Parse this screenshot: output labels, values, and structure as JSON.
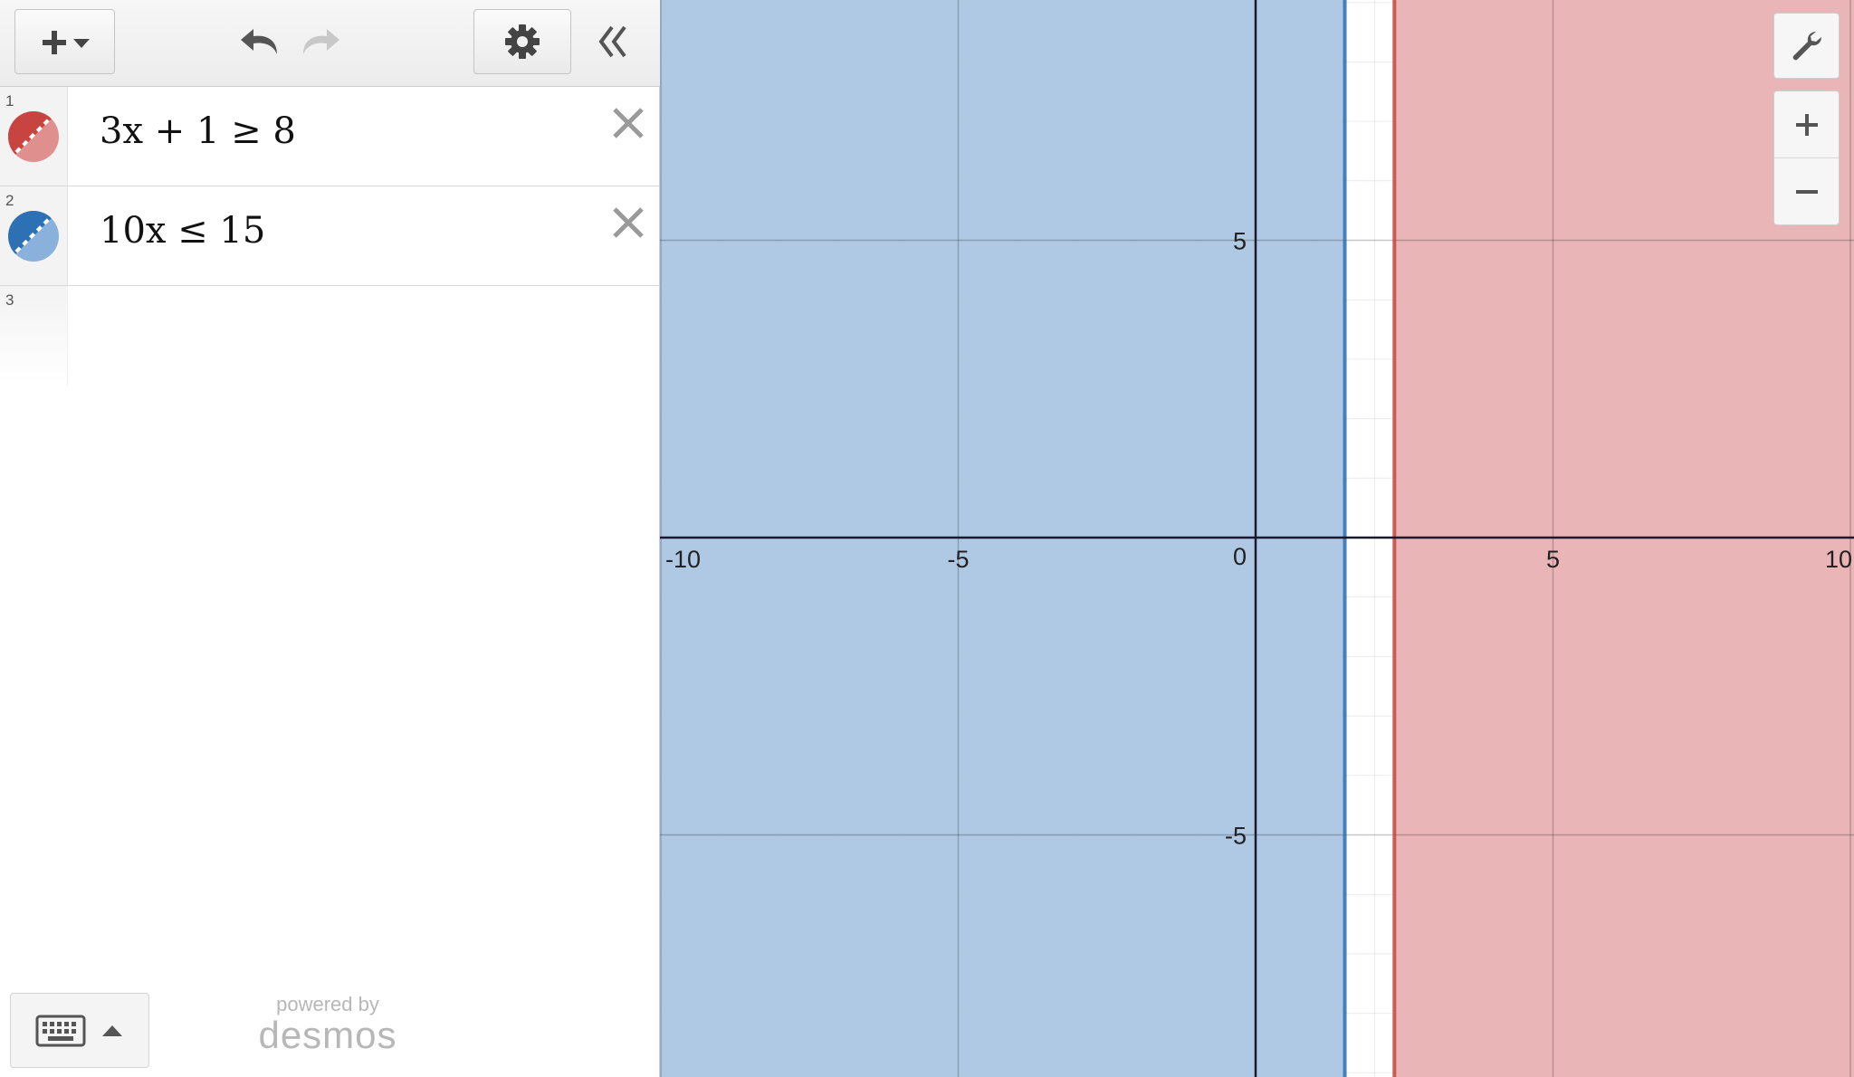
{
  "toolbar": {
    "add_icon": "plus-with-dropdown-icon",
    "undo_icon": "undo-icon",
    "redo_icon": "redo-icon",
    "settings_icon": "gear-icon",
    "collapse_icon": "double-chevron-left-icon"
  },
  "expressions": [
    {
      "index": "1",
      "latex": "3x + 1 ≥ 8",
      "color": "#c74440",
      "fill": "#e08f8f"
    },
    {
      "index": "2",
      "latex": "10x ≤ 15",
      "color": "#2d70b3",
      "fill": "#8ab0dc"
    },
    {
      "index": "3",
      "latex": ""
    }
  ],
  "footer": {
    "keyboard_icon": "keyboard-icon",
    "expand_icon": "caret-up-icon",
    "powered_by": "powered by",
    "brand": "desmos"
  },
  "graph": {
    "x_range": [
      -10,
      10
    ],
    "y_range": [
      -9,
      9
    ],
    "x_ticks": [
      "-10",
      "-5",
      "0",
      "5",
      "10"
    ],
    "y_ticks": [
      "5",
      "-5"
    ],
    "origin_label": "0",
    "x_tick_values": [
      -10,
      -5,
      5,
      10
    ],
    "y_tick_values": [
      5,
      -5
    ],
    "regions": [
      {
        "name": "x >= 7/3",
        "from": 2.3333,
        "to": 10,
        "color": "#c74440",
        "fill": "#e8b1b3"
      },
      {
        "name": "x <= 1.5",
        "from": -10,
        "to": 1.5,
        "color": "#2d70b3",
        "fill": "#abc5e1"
      }
    ]
  },
  "controls": {
    "wrench_icon": "wrench-icon",
    "zoom_in_icon": "plus-icon",
    "zoom_out_icon": "minus-icon"
  }
}
